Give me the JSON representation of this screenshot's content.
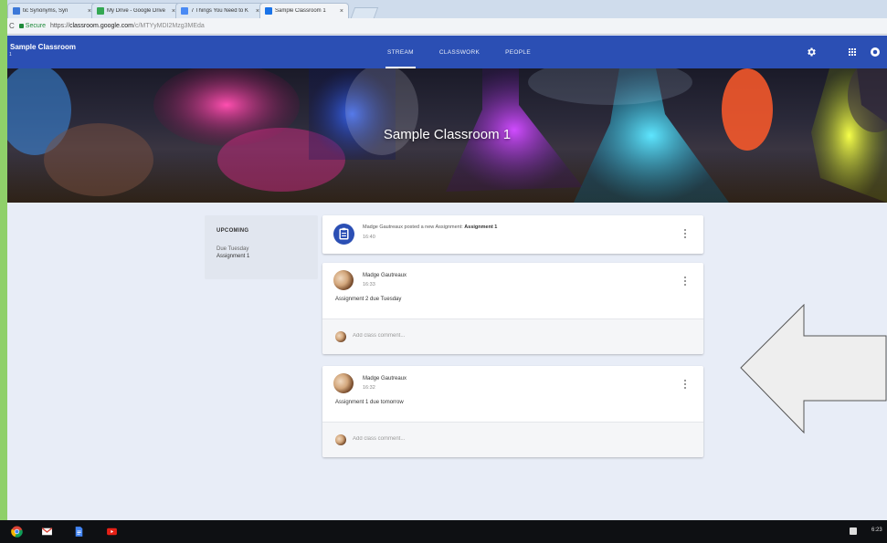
{
  "browser": {
    "tabs": [
      {
        "title": "tic Synonyms, Syn",
        "close": "×",
        "icon_color": "#3c78d8",
        "active": false
      },
      {
        "title": "My Drive - Google Drive",
        "close": "×",
        "icon_color": "#34a853",
        "active": false
      },
      {
        "title": "7 Things You Need to K",
        "close": "×",
        "icon_color": "#4a8af4",
        "active": false
      },
      {
        "title": "Sample Classroom 1",
        "close": "×",
        "icon_color": "#1a73e8",
        "active": true
      }
    ],
    "secure_label": "Secure",
    "url_scheme": "https://",
    "url_host": "classroom.google.com",
    "url_path": "/c/MTYyMDI2Mzg3MEda"
  },
  "appbar": {
    "brand": "Sample Classroom",
    "brand_sub": "1",
    "nav": [
      {
        "label": "STREAM",
        "active": true
      },
      {
        "label": "CLASSWORK",
        "active": false
      },
      {
        "label": "PEOPLE",
        "active": false
      }
    ],
    "color": "#2b4fb4"
  },
  "banner": {
    "title": "Sample Classroom 1"
  },
  "upcoming": {
    "heading": "UPCOMING",
    "due": "Due Tuesday",
    "item": "Assignment 1"
  },
  "stream": {
    "announcement": {
      "text_prefix": "Madge Gautreaux posted a new Assignment: ",
      "assignment": "Assignment 1",
      "time": "16:40",
      "icon": "assignment-icon"
    },
    "posts": [
      {
        "author": "Madge Gautreaux",
        "time": "16:33",
        "body": "Assignment 2 due Tuesday",
        "comment_placeholder": "Add class comment..."
      },
      {
        "author": "Madge Gautreaux",
        "time": "16:32",
        "body": "Assignment 1 due tomorrow",
        "comment_placeholder": "Add class comment..."
      }
    ]
  },
  "taskbar": {
    "apps": [
      "chrome-icon",
      "gmail-icon",
      "docs-icon",
      "youtube-icon"
    ],
    "clock": "6:23"
  }
}
